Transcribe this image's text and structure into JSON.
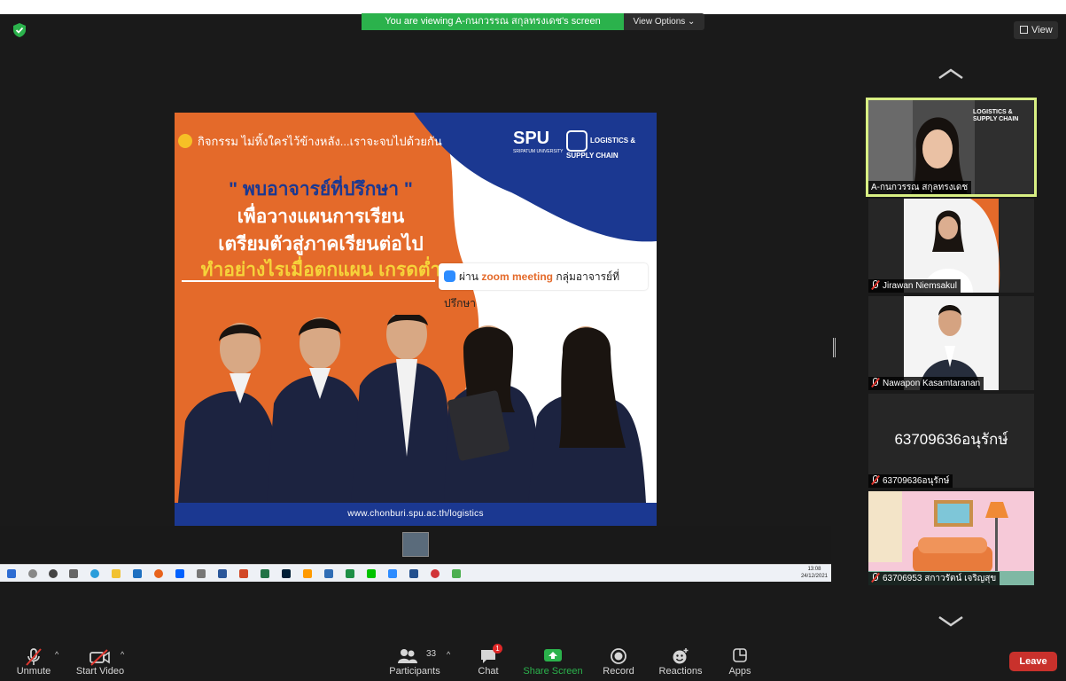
{
  "banner": {
    "text": "You are viewing A-กนกวรรณ สกุลทรงเดช's screen",
    "options_label": "View Options ⌄"
  },
  "view_button": {
    "label": "View"
  },
  "slide": {
    "top_text": "กิจกรรม ไม่ทิ้งใครไว้ข้างหลัง...เราจะจบไปด้วยกัน",
    "logo_spu": "SPU",
    "logo_spu_sub": "SRIPATUM UNIVERSITY",
    "logo_lsc": "LOGISTICS & SUPPLY CHAIN",
    "heading_1": "\" พบอาจารย์ที่ปรึกษา \"",
    "heading_2": "เพื่อวางแผนการเรียน",
    "heading_3": "เตรียมตัวสู่ภาคเรียนต่อไป",
    "heading_4": "ทำอย่างไรเมื่อตกแผน เกรดต่ำ",
    "pill_prefix": "ผ่าน",
    "pill_zoom": "zoom meeting",
    "pill_suffix": "กลุ่มอาจารย์ที่ปรึกษา",
    "footer_url": "www.chonburi.spu.ac.th/logistics"
  },
  "taskbar": {
    "time": "13:08",
    "date": "24/12/2021"
  },
  "participants_tiles": [
    {
      "name": "A-กนกวรรณ สกุลทรงเดช",
      "active": true,
      "video_overlay": "LOGISTICS & SUPPLY CHAIN"
    },
    {
      "name": "Jirawan Niemsakul",
      "muted": true
    },
    {
      "name": "Nawapon Kasamtaranan",
      "muted": true
    },
    {
      "name": "63709636อนุรักษ์",
      "display": "63709636อนุรักษ์",
      "muted": true
    },
    {
      "name": "63706953 สกาวรัตน์ เจริญสุข",
      "muted": true
    }
  ],
  "toolbar": {
    "unmute": "Unmute",
    "start_video": "Start Video",
    "participants": "Participants",
    "participants_count": "33",
    "chat": "Chat",
    "chat_badge": "1",
    "share_screen": "Share Screen",
    "record": "Record",
    "reactions": "Reactions",
    "apps": "Apps",
    "leave": "Leave"
  },
  "colors": {
    "share_green": "#2bb24c",
    "leave_red": "#c9312c",
    "active_tile": "#d8ef83",
    "slide_orange": "#e46a2a",
    "slide_blue": "#1b3891"
  }
}
